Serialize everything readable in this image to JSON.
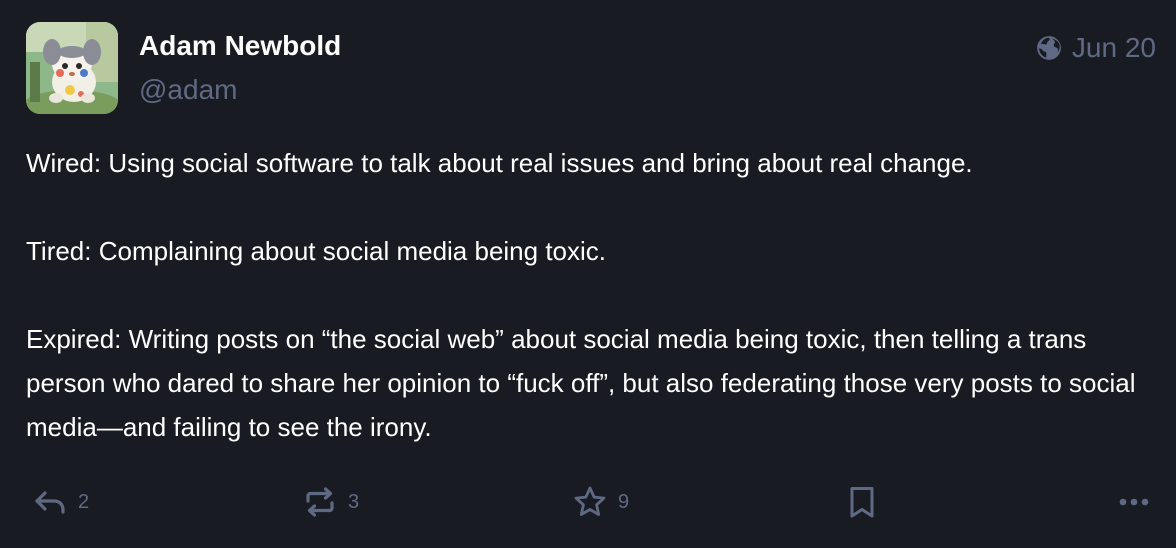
{
  "author": {
    "display_name": "Adam Newbold",
    "handle": "@adam"
  },
  "post": {
    "date": "Jun 20",
    "visibility_icon": "globe-icon",
    "paragraphs": [
      "Wired: Using social software to talk about real issues and bring about real change.",
      "Tired: Complaining about social media being toxic.",
      "Expired: Writing posts on “the social web” about social media being toxic, then telling a trans person who dared to share her opinion to “fuck off”, but also federating those very posts to social media—and failing to see the irony."
    ]
  },
  "actions": {
    "reply": {
      "icon": "reply-icon",
      "count": "2"
    },
    "boost": {
      "icon": "boost-icon",
      "count": "3"
    },
    "favourite": {
      "icon": "star-icon",
      "count": "9"
    },
    "bookmark": {
      "icon": "bookmark-icon"
    },
    "more": {
      "icon": "more-icon"
    }
  },
  "colors": {
    "background": "#191b22",
    "text": "#ffffff",
    "muted": "#606984"
  }
}
